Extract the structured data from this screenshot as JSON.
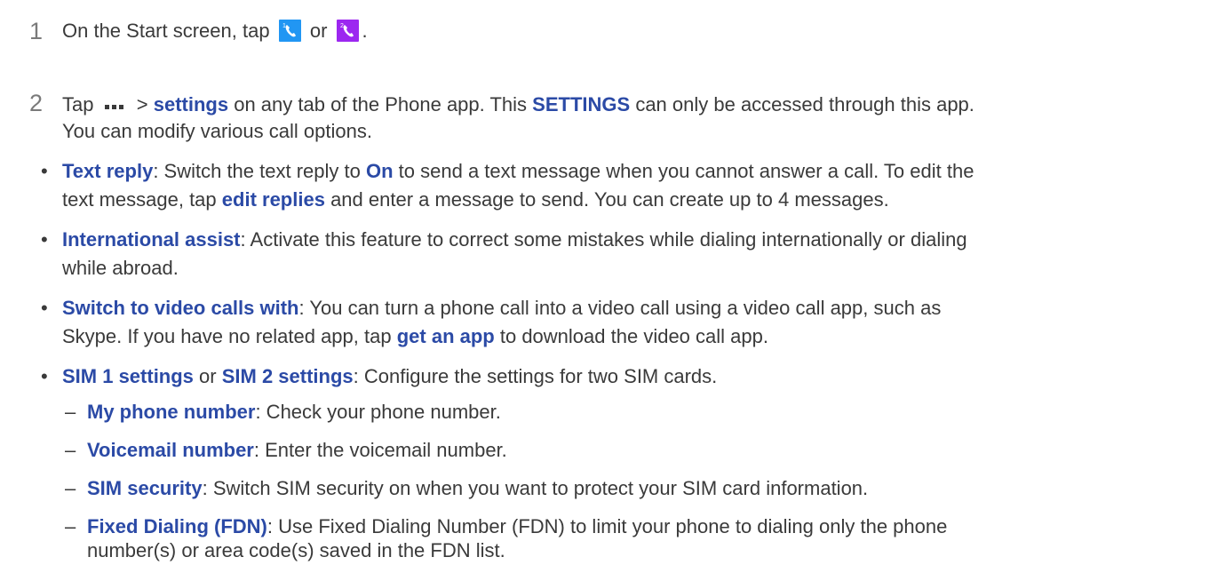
{
  "colors": {
    "highlight": "#2b4aa6",
    "sim1_icon_bg": "#2196f3",
    "sim2_icon_bg": "#9c27f0"
  },
  "step1": {
    "number": "1",
    "pre": "On the Start screen, tap",
    "or": "or",
    "end": ".",
    "icon1": "sim1-phone-icon",
    "icon2": "sim2-phone-icon"
  },
  "step2": {
    "number": "2",
    "t1": "Tap",
    "icon": "more-dots-icon",
    "t2": ">",
    "settings": "settings",
    "t3": "on any tab of the Phone app. This",
    "SETTINGS": "SETTINGS",
    "t4": "can only be accessed through this app.",
    "line2": "You can modify various call options."
  },
  "text_reply": {
    "label": "Text reply",
    "t1": ": Switch the text reply to",
    "on": "On",
    "t2": "to send a text message when you cannot answer a call. To edit the",
    "t3": "text message, tap",
    "edit_replies": "edit replies",
    "t4": "and enter a message to send. You can create up to 4 messages."
  },
  "international_assist": {
    "label": "International assist",
    "t1": ": Activate this feature to correct some mistakes while dialing internationally or dialing",
    "t2": "while abroad."
  },
  "switch_video": {
    "label": "Switch to video calls with",
    "t1": ": You can turn a phone call into a video call using a video call app, such as",
    "t2": "Skype. If you have no related app, tap",
    "get_app": "get an app",
    "t3": "to download the video call app."
  },
  "sim_settings": {
    "sim1": "SIM 1 settings",
    "or": "or",
    "sim2": "SIM 2 settings",
    "t1": ": Configure the settings for two SIM cards."
  },
  "sub_items": [
    {
      "label": "My phone number",
      "text": ": Check your phone number."
    },
    {
      "label": "Voicemail number",
      "text": ": Enter the voicemail number."
    },
    {
      "label": "SIM security",
      "text": ": Switch SIM security on when you want to protect your SIM card information."
    },
    {
      "label": "Fixed Dialing (FDN)",
      "text": ": Use Fixed Dialing Number (FDN) to limit your phone to dialing only the phone",
      "text2": "number(s) or area code(s) saved in the FDN list."
    }
  ],
  "bullet_char": "•",
  "dash_char": "–"
}
